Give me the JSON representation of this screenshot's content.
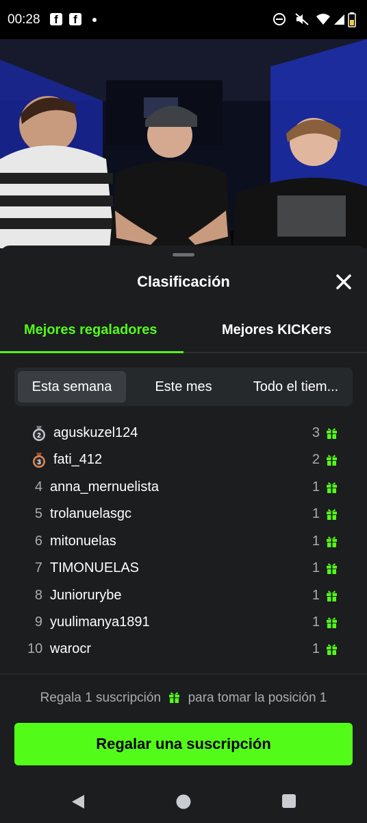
{
  "status_bar": {
    "time": "00:28",
    "app_icon_letter": "f"
  },
  "sheet": {
    "title": "Clasificación",
    "tabs": [
      {
        "label": "Mejores regaladores",
        "active": true
      },
      {
        "label": "Mejores KICKers",
        "active": false
      }
    ],
    "periods": [
      {
        "label": "Esta semana",
        "selected": true
      },
      {
        "label": "Este mes",
        "selected": false
      },
      {
        "label": "Todo el tiem...",
        "selected": false
      }
    ],
    "leaderboard": [
      {
        "rank": "2",
        "name": "aguskuzel124",
        "count": "3",
        "medal": "silver"
      },
      {
        "rank": "3",
        "name": "fati_412",
        "count": "2",
        "medal": "bronze"
      },
      {
        "rank": "4",
        "name": "anna_mernuelista",
        "count": "1"
      },
      {
        "rank": "5",
        "name": "trolanuelasgc",
        "count": "1"
      },
      {
        "rank": "6",
        "name": "mitonuelas",
        "count": "1"
      },
      {
        "rank": "7",
        "name": "TIMONUELAS",
        "count": "1"
      },
      {
        "rank": "8",
        "name": "Juniorurybe",
        "count": "1"
      },
      {
        "rank": "9",
        "name": "yuulimanya1891",
        "count": "1"
      },
      {
        "rank": "10",
        "name": "warocr",
        "count": "1"
      }
    ],
    "cta": {
      "text_before": "Regala 1  suscripción",
      "text_after": "para tomar la posición 1",
      "button_label": "Regalar una suscripción"
    }
  },
  "colors": {
    "accent": "#53fc18",
    "background": "#1b1d1f",
    "muted_text": "#a9adb1"
  }
}
